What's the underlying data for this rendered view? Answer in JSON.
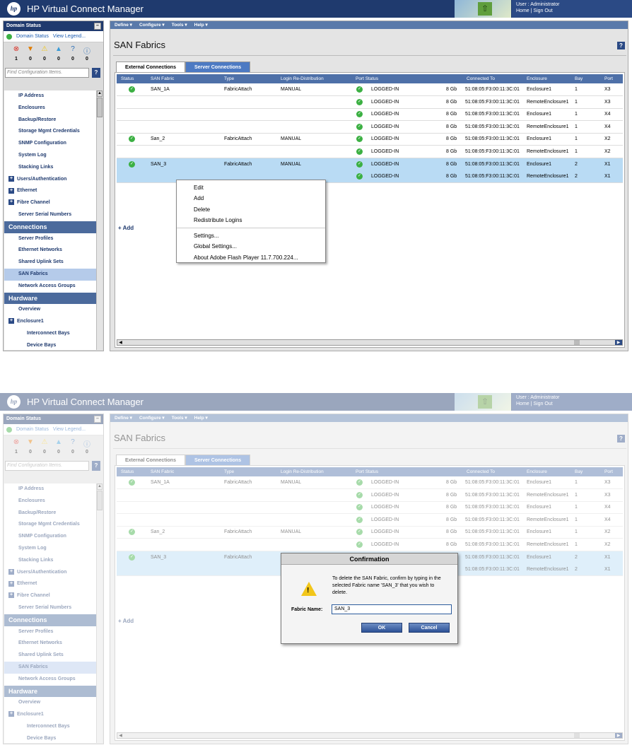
{
  "app": {
    "logo": "hp",
    "title": "HP Virtual Connect Manager",
    "user_line": "User : Administrator",
    "home": "Home",
    "sign_out": "Sign Out"
  },
  "sidebar": {
    "header": "Domain Status",
    "collapse_label": "–",
    "domain_status_link": "Domain Status",
    "view_legend_link": "View Legend...",
    "status_icons": [
      {
        "icon": "critical-icon",
        "glyph": "⊗",
        "color": "#d93025",
        "count": "1"
      },
      {
        "icon": "major-icon",
        "glyph": "▼",
        "color": "#e07b00",
        "count": "0"
      },
      {
        "icon": "minor-icon",
        "glyph": "⚠",
        "color": "#f2c61a",
        "count": "0"
      },
      {
        "icon": "warning-icon",
        "glyph": "▲",
        "color": "#3a9bd6",
        "count": "0"
      },
      {
        "icon": "unknown-icon",
        "glyph": "?",
        "color": "#2d6fb8",
        "count": "0"
      },
      {
        "icon": "info-icon",
        "glyph": "ⓘ",
        "color": "#2d6fb8",
        "count": "0"
      }
    ],
    "find_placeholder": "Find Configuration Items.",
    "help_label": "?",
    "items": [
      {
        "label": "IP Address",
        "kind": "item"
      },
      {
        "label": "Enclosures",
        "kind": "item"
      },
      {
        "label": "Backup/Restore",
        "kind": "item"
      },
      {
        "label": "Storage Mgmt Credentials",
        "kind": "item"
      },
      {
        "label": "SNMP Configuration",
        "kind": "item"
      },
      {
        "label": "System Log",
        "kind": "item"
      },
      {
        "label": "Stacking Links",
        "kind": "item"
      },
      {
        "label": "Users/Authentication",
        "kind": "exp"
      },
      {
        "label": "Ethernet",
        "kind": "exp"
      },
      {
        "label": "Fibre Channel",
        "kind": "exp"
      },
      {
        "label": "Server Serial Numbers",
        "kind": "item"
      },
      {
        "label": "Connections",
        "kind": "sec"
      },
      {
        "label": "Server Profiles",
        "kind": "item"
      },
      {
        "label": "Ethernet Networks",
        "kind": "item"
      },
      {
        "label": "Shared Uplink Sets",
        "kind": "item"
      },
      {
        "label": "SAN Fabrics",
        "kind": "sel"
      },
      {
        "label": "Network Access Groups",
        "kind": "item"
      },
      {
        "label": "Hardware",
        "kind": "sec"
      },
      {
        "label": "Overview",
        "kind": "item"
      },
      {
        "label": "Enclosure1",
        "kind": "exp"
      },
      {
        "label": "Interconnect Bays",
        "kind": "sub"
      },
      {
        "label": "Device Bays",
        "kind": "sub"
      }
    ]
  },
  "menu": [
    "Define ▾",
    "Configure ▾",
    "Tools ▾",
    "Help ▾"
  ],
  "page": {
    "title": "SAN Fabrics",
    "help": "?",
    "tabs": [
      "External Connections",
      "Server Connections"
    ],
    "columns": [
      "Status",
      "SAN Fabric",
      "Type",
      "Login Re-Distribution",
      "Port Status",
      "Connected To",
      "Enclosure",
      "Bay",
      "Port"
    ],
    "rows": [
      {
        "fabric": "SAN_1A",
        "type": "FabricAttach",
        "login": "MANUAL",
        "port_status": "LOGGED-IN",
        "speed": "8 Gb",
        "connected": "51:08:05:F3:00:11:3C:01",
        "enclosure": "Enclosure1",
        "bay": "1",
        "port": "X3"
      },
      {
        "fabric": "",
        "type": "",
        "login": "",
        "port_status": "LOGGED-IN",
        "speed": "8 Gb",
        "connected": "51:08:05:F3:00:11:3C:01",
        "enclosure": "RemoteEnclosure1",
        "bay": "1",
        "port": "X3"
      },
      {
        "fabric": "",
        "type": "",
        "login": "",
        "port_status": "LOGGED-IN",
        "speed": "8 Gb",
        "connected": "51:08:05:F3:00:11:3C:01",
        "enclosure": "Enclosure1",
        "bay": "1",
        "port": "X4"
      },
      {
        "fabric": "",
        "type": "",
        "login": "",
        "port_status": "LOGGED-IN",
        "speed": "8 Gb",
        "connected": "51:08:05:F3:00:11:3C:01",
        "enclosure": "RemoteEnclosure1",
        "bay": "1",
        "port": "X4"
      },
      {
        "fabric": "San_2",
        "type": "FabricAttach",
        "login": "MANUAL",
        "port_status": "LOGGED-IN",
        "speed": "8 Gb",
        "connected": "51:08:05:F3:00:11:3C:01",
        "enclosure": "Enclosure1",
        "bay": "1",
        "port": "X2"
      },
      {
        "fabric": "",
        "type": "",
        "login": "",
        "port_status": "LOGGED-IN",
        "speed": "8 Gb",
        "connected": "51:08:05:F3:00:11:3C:01",
        "enclosure": "RemoteEnclosure1",
        "bay": "1",
        "port": "X2"
      },
      {
        "fabric": "SAN_3",
        "type": "FabricAttach",
        "login": "MANUAL",
        "port_status": "LOGGED-IN",
        "speed": "8 Gb",
        "connected": "51:08:05:F3:00:11:3C:01",
        "enclosure": "Enclosure1",
        "bay": "2",
        "port": "X1"
      },
      {
        "fabric": "",
        "type": "",
        "login": "",
        "port_status": "LOGGED-IN",
        "speed": "8 Gb",
        "connected": "51:08:05:F3:00:11:3C:01",
        "enclosure": "RemoteEnclosure1",
        "bay": "2",
        "port": "X1"
      }
    ],
    "add_label": "Add"
  },
  "context_menu": {
    "group1": [
      "Edit",
      "Add",
      "Delete",
      "Redistribute Logins"
    ],
    "group2": [
      "Settings...",
      "Global Settings...",
      "About Adobe Flash Player 11.7.700.224..."
    ]
  },
  "dialog": {
    "title": "Confirmation",
    "message": "To delete the SAN Fabric, confirm by typing in the selected Fabric name 'SAN_3' that you wish to delete.",
    "field_label": "Fabric Name:",
    "field_value": "SAN_3",
    "ok": "OK",
    "cancel": "Cancel"
  },
  "colors": {
    "header": "#1f3a6e",
    "accent": "#4d7ac3",
    "selected_row": "#b9dbf4",
    "ok_status": "#3cb043"
  }
}
